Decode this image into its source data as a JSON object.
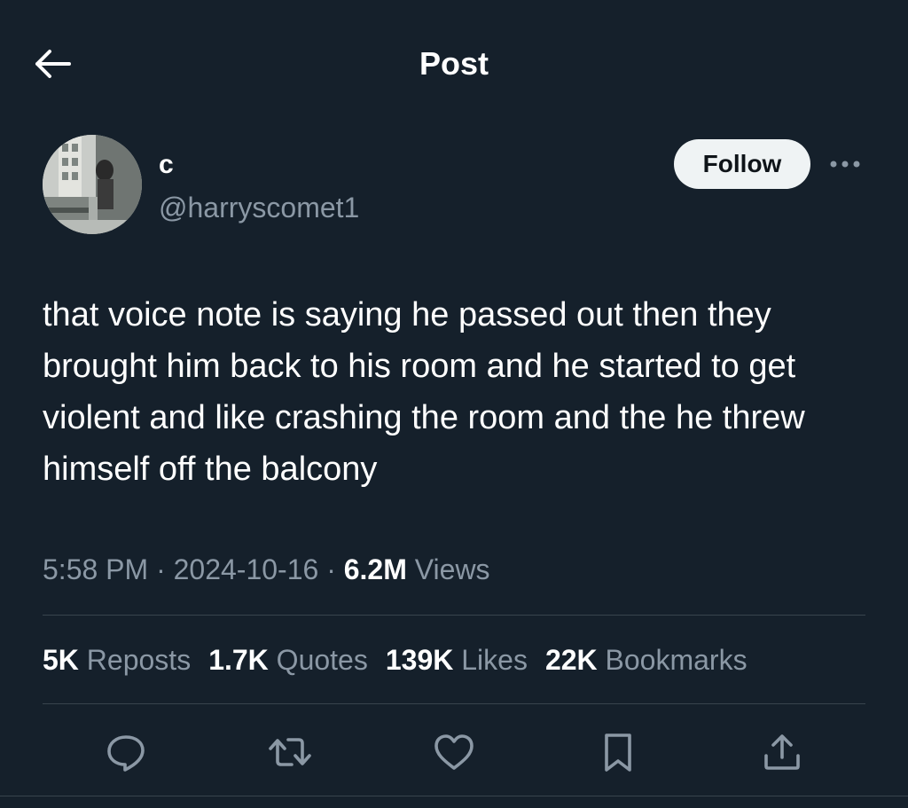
{
  "header": {
    "title": "Post",
    "back_icon": "arrow-left-icon"
  },
  "author": {
    "display_name": "c",
    "handle": "@harryscomet1",
    "follow_label": "Follow",
    "more_icon": "more-dots-icon"
  },
  "post": {
    "text": "that voice note is saying he passed out then they brought him back to his room and he started to get violent and like crashing the room and the he threw himself off the balcony",
    "time": "5:58 PM",
    "date": "2024-10-16",
    "views_count": "6.2M",
    "views_label": "Views"
  },
  "stats": [
    {
      "count": "5K",
      "label": "Reposts"
    },
    {
      "count": "1.7K",
      "label": "Quotes"
    },
    {
      "count": "139K",
      "label": "Likes"
    },
    {
      "count": "22K",
      "label": "Bookmarks"
    }
  ],
  "actions": [
    "reply-icon",
    "repost-icon",
    "like-icon",
    "bookmark-icon",
    "share-icon"
  ],
  "colors": {
    "background": "#15202b",
    "text": "#ffffff",
    "secondary_text": "#8b98a5",
    "divider": "#38444d",
    "follow_button_bg": "#eff3f4"
  }
}
